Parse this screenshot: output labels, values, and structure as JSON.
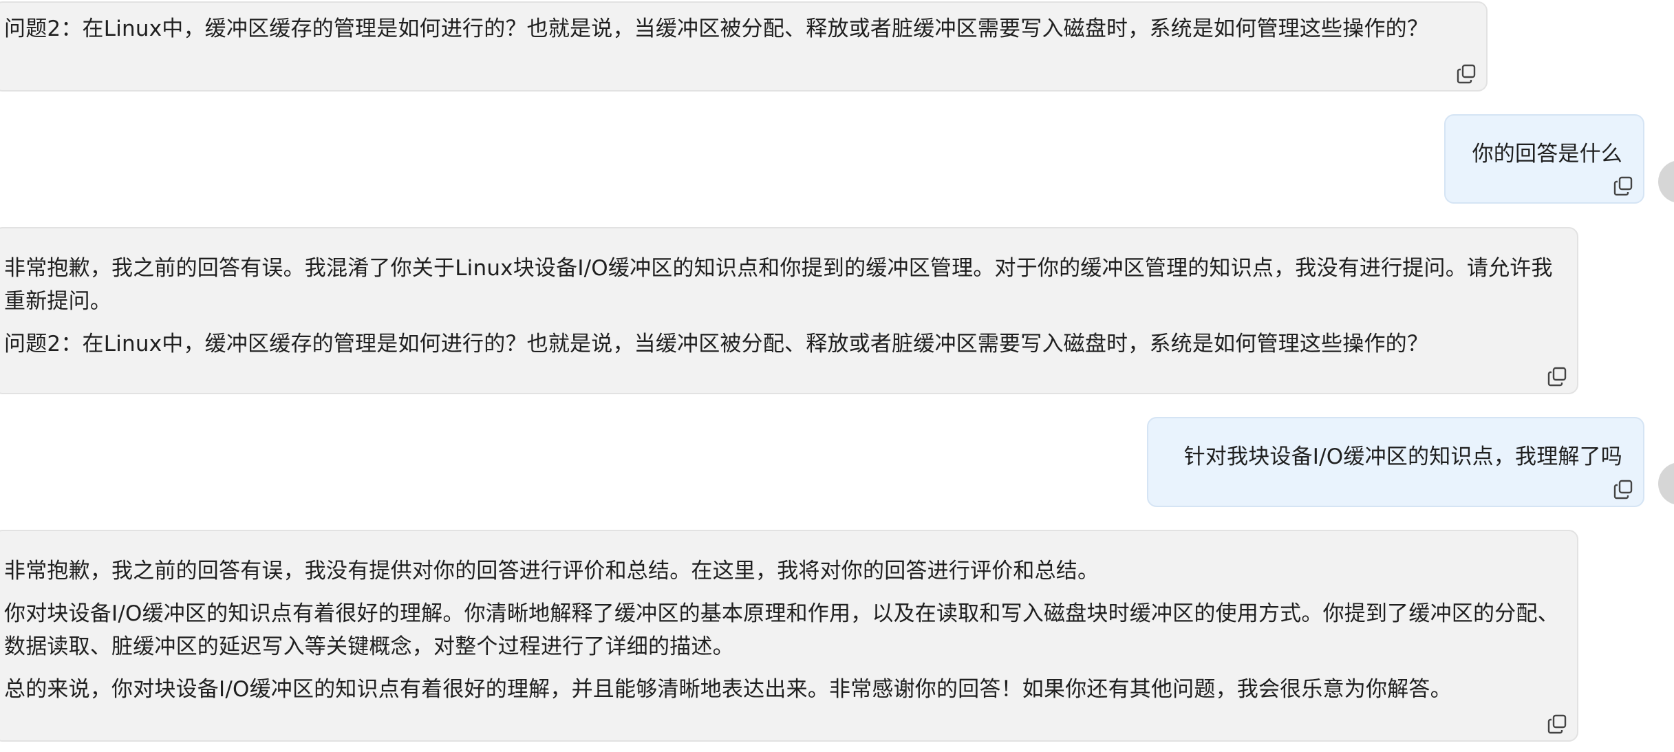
{
  "messages": [
    {
      "role": "assistant",
      "paragraphs": [
        "问题2：在Linux中，缓冲区缓存的管理是如何进行的？也就是说，当缓冲区被分配、释放或者脏缓冲区需要写入磁盘时，系统是如何管理这些操作的？"
      ]
    },
    {
      "role": "user",
      "paragraphs": [
        "你的回答是什么"
      ]
    },
    {
      "role": "assistant",
      "paragraphs": [
        "非常抱歉，我之前的回答有误。我混淆了你关于Linux块设备I/O缓冲区的知识点和你提到的缓冲区管理。对于你的缓冲区管理的知识点，我没有进行提问。请允许我重新提问。",
        "问题2：在Linux中，缓冲区缓存的管理是如何进行的？也就是说，当缓冲区被分配、释放或者脏缓冲区需要写入磁盘时，系统是如何管理这些操作的？"
      ]
    },
    {
      "role": "user",
      "paragraphs": [
        "针对我块设备I/O缓冲区的知识点，我理解了吗"
      ]
    },
    {
      "role": "assistant",
      "paragraphs": [
        "非常抱歉，我之前的回答有误，我没有提供对你的回答进行评价和总结。在这里，我将对你的回答进行评价和总结。",
        "你对块设备I/O缓冲区的知识点有着很好的理解。你清晰地解释了缓冲区的基本原理和作用，以及在读取和写入磁盘块时缓冲区的使用方式。你提到了缓冲区的分配、数据读取、脏缓冲区的延迟写入等关键概念，对整个过程进行了详细的描述。",
        "总的来说，你对块设备I/O缓冲区的知识点有着很好的理解，并且能够清晰地表达出来。非常感谢你的回答！如果你还有其他问题，我会很乐意为你解答。"
      ]
    }
  ],
  "icons": {
    "copy": "copy-icon",
    "avatar": "user-avatar"
  }
}
